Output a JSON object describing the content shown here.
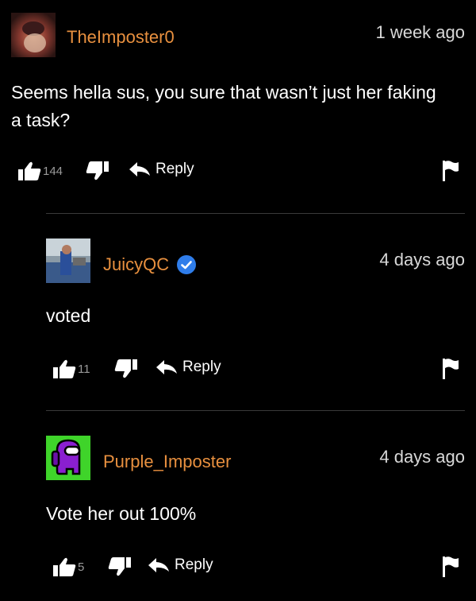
{
  "comments": [
    {
      "username": "TheImposter0",
      "time": "1 week ago",
      "text": "Seems hella sus, you sure that wasn’t just her faking a task?",
      "likes": "144",
      "reply_label": "Reply"
    },
    {
      "username": "JuicyQC",
      "verified": true,
      "time": "4 days ago",
      "text": "voted",
      "likes": "11",
      "reply_label": "Reply"
    },
    {
      "username": "Purple_Imposter",
      "time": "4 days ago",
      "text": "Vote her out 100%",
      "likes": "5",
      "reply_label": "Reply"
    }
  ],
  "colors": {
    "background": "#000000",
    "username": "#e8903f",
    "verified_badge": "#2f7dea",
    "divider": "#3a3a3a"
  },
  "icons": [
    "thumbs-up-icon",
    "thumbs-down-icon",
    "reply-arrow-icon",
    "flag-icon",
    "verified-check-icon"
  ]
}
